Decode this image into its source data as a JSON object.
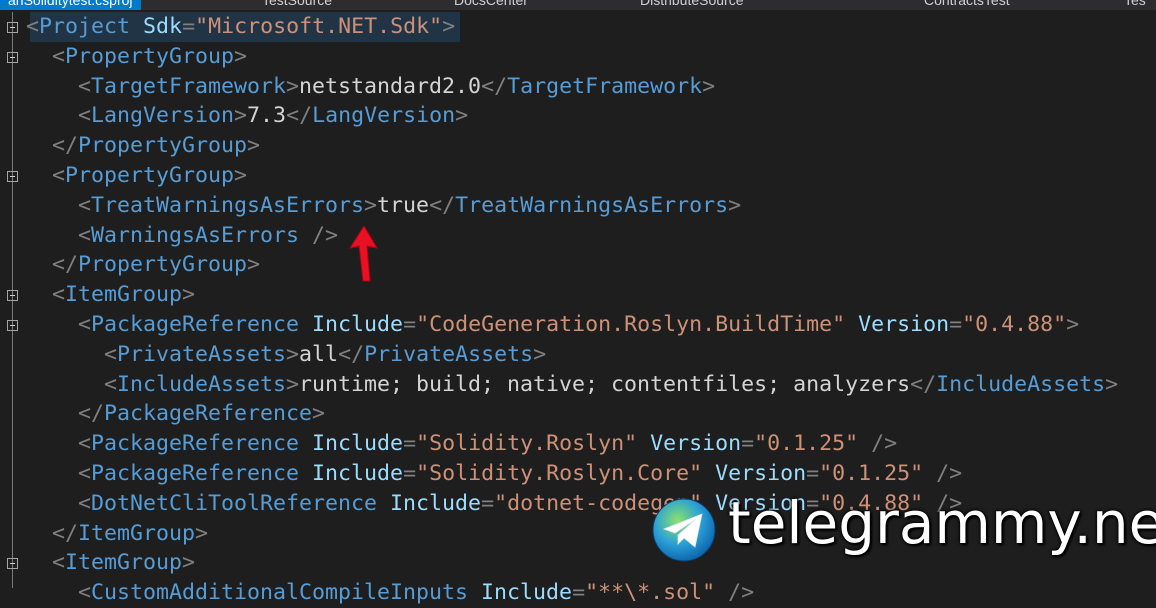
{
  "tabs": [
    {
      "label": "anSoliditytest.csproj",
      "active": true
    },
    {
      "label": "TestSource",
      "active": false
    },
    {
      "label": "DocsCenter",
      "active": false
    },
    {
      "label": "DistributeSource",
      "active": false
    },
    {
      "label": "ContractsTest",
      "active": false
    },
    {
      "label": "Tes",
      "active": false
    }
  ],
  "colors": {
    "background": "#1e1e1e",
    "punctuation": "#808080",
    "tag": "#569cd6",
    "attribute": "#9cdcfe",
    "string_value": "#ce9178",
    "text": "#d4d4d4",
    "arrow": "#e81123",
    "active_tab": "#007acc"
  },
  "code_lines": [
    {
      "collapsible": true,
      "tokens": [
        [
          "punct",
          "<"
        ],
        [
          "tag",
          "Project"
        ],
        [
          "txt",
          " "
        ],
        [
          "attr",
          "Sdk"
        ],
        [
          "punct",
          "="
        ],
        [
          "val",
          "\"Microsoft.NET.Sdk\""
        ],
        [
          "punct",
          ">"
        ]
      ]
    },
    {
      "collapsible": true,
      "tokens": [
        [
          "punct",
          "<"
        ],
        [
          "tag",
          "PropertyGroup"
        ],
        [
          "punct",
          ">"
        ]
      ]
    },
    {
      "collapsible": false,
      "tokens": [
        [
          "punct",
          "<"
        ],
        [
          "tag",
          "TargetFramework"
        ],
        [
          "punct",
          ">"
        ],
        [
          "txt",
          "netstandard2.0"
        ],
        [
          "punct",
          "</"
        ],
        [
          "tag",
          "TargetFramework"
        ],
        [
          "punct",
          ">"
        ]
      ]
    },
    {
      "collapsible": false,
      "tokens": [
        [
          "punct",
          "<"
        ],
        [
          "tag",
          "LangVersion"
        ],
        [
          "punct",
          ">"
        ],
        [
          "txt",
          "7.3"
        ],
        [
          "punct",
          "</"
        ],
        [
          "tag",
          "LangVersion"
        ],
        [
          "punct",
          ">"
        ]
      ]
    },
    {
      "collapsible": false,
      "tokens": [
        [
          "punct",
          "</"
        ],
        [
          "tag",
          "PropertyGroup"
        ],
        [
          "punct",
          ">"
        ]
      ]
    },
    {
      "collapsible": true,
      "tokens": [
        [
          "punct",
          "<"
        ],
        [
          "tag",
          "PropertyGroup"
        ],
        [
          "punct",
          ">"
        ]
      ]
    },
    {
      "collapsible": false,
      "tokens": [
        [
          "punct",
          "<"
        ],
        [
          "tag",
          "TreatWarningsAsErrors"
        ],
        [
          "punct",
          ">"
        ],
        [
          "txt",
          "true"
        ],
        [
          "punct",
          "</"
        ],
        [
          "tag",
          "TreatWarningsAsErrors"
        ],
        [
          "punct",
          ">"
        ]
      ]
    },
    {
      "collapsible": false,
      "tokens": [
        [
          "punct",
          "<"
        ],
        [
          "tag",
          "WarningsAsErrors"
        ],
        [
          "txt",
          " "
        ],
        [
          "punct",
          "/>"
        ]
      ]
    },
    {
      "collapsible": false,
      "tokens": [
        [
          "punct",
          "</"
        ],
        [
          "tag",
          "PropertyGroup"
        ],
        [
          "punct",
          ">"
        ]
      ]
    },
    {
      "collapsible": true,
      "tokens": [
        [
          "punct",
          "<"
        ],
        [
          "tag",
          "ItemGroup"
        ],
        [
          "punct",
          ">"
        ]
      ]
    },
    {
      "collapsible": true,
      "tokens": [
        [
          "punct",
          "<"
        ],
        [
          "tag",
          "PackageReference"
        ],
        [
          "txt",
          " "
        ],
        [
          "attr",
          "Include"
        ],
        [
          "punct",
          "="
        ],
        [
          "val",
          "\"CodeGeneration.Roslyn.BuildTime\""
        ],
        [
          "txt",
          " "
        ],
        [
          "attr",
          "Version"
        ],
        [
          "punct",
          "="
        ],
        [
          "val",
          "\"0.4.88\""
        ],
        [
          "punct",
          ">"
        ]
      ]
    },
    {
      "collapsible": false,
      "tokens": [
        [
          "punct",
          "<"
        ],
        [
          "tag",
          "PrivateAssets"
        ],
        [
          "punct",
          ">"
        ],
        [
          "txt",
          "all"
        ],
        [
          "punct",
          "</"
        ],
        [
          "tag",
          "PrivateAssets"
        ],
        [
          "punct",
          ">"
        ]
      ]
    },
    {
      "collapsible": false,
      "tokens": [
        [
          "punct",
          "<"
        ],
        [
          "tag",
          "IncludeAssets"
        ],
        [
          "punct",
          ">"
        ],
        [
          "txt",
          "runtime; build; native; contentfiles; analyzers"
        ],
        [
          "punct",
          "</"
        ],
        [
          "tag",
          "IncludeAssets"
        ],
        [
          "punct",
          ">"
        ]
      ]
    },
    {
      "collapsible": false,
      "tokens": [
        [
          "punct",
          "</"
        ],
        [
          "tag",
          "PackageReference"
        ],
        [
          "punct",
          ">"
        ]
      ]
    },
    {
      "collapsible": false,
      "tokens": [
        [
          "punct",
          "<"
        ],
        [
          "tag",
          "PackageReference"
        ],
        [
          "txt",
          " "
        ],
        [
          "attr",
          "Include"
        ],
        [
          "punct",
          "="
        ],
        [
          "val",
          "\"Solidity.Roslyn\""
        ],
        [
          "txt",
          " "
        ],
        [
          "attr",
          "Version"
        ],
        [
          "punct",
          "="
        ],
        [
          "val",
          "\"0.1.25\""
        ],
        [
          "txt",
          " "
        ],
        [
          "punct",
          "/>"
        ]
      ]
    },
    {
      "collapsible": false,
      "tokens": [
        [
          "punct",
          "<"
        ],
        [
          "tag",
          "PackageReference"
        ],
        [
          "txt",
          " "
        ],
        [
          "attr",
          "Include"
        ],
        [
          "punct",
          "="
        ],
        [
          "val",
          "\"Solidity.Roslyn.Core\""
        ],
        [
          "txt",
          " "
        ],
        [
          "attr",
          "Version"
        ],
        [
          "punct",
          "="
        ],
        [
          "val",
          "\"0.1.25\""
        ],
        [
          "txt",
          " "
        ],
        [
          "punct",
          "/>"
        ]
      ]
    },
    {
      "collapsible": false,
      "tokens": [
        [
          "punct",
          "<"
        ],
        [
          "tag",
          "DotNetCliToolReference"
        ],
        [
          "txt",
          " "
        ],
        [
          "attr",
          "Include"
        ],
        [
          "punct",
          "="
        ],
        [
          "val",
          "\"dotnet-codegen\""
        ],
        [
          "txt",
          " "
        ],
        [
          "attr",
          "Version"
        ],
        [
          "punct",
          "="
        ],
        [
          "val",
          "\"0.4.88\""
        ],
        [
          "txt",
          " "
        ],
        [
          "punct",
          "/>"
        ]
      ]
    },
    {
      "collapsible": false,
      "tokens": [
        [
          "punct",
          "</"
        ],
        [
          "tag",
          "ItemGroup"
        ],
        [
          "punct",
          ">"
        ]
      ]
    },
    {
      "collapsible": true,
      "tokens": [
        [
          "punct",
          "<"
        ],
        [
          "tag",
          "ItemGroup"
        ],
        [
          "punct",
          ">"
        ]
      ]
    },
    {
      "collapsible": false,
      "tokens": [
        [
          "punct",
          "<"
        ],
        [
          "tag",
          "CustomAdditionalCompileInputs"
        ],
        [
          "txt",
          " "
        ],
        [
          "attr",
          "Include"
        ],
        [
          "punct",
          "="
        ],
        [
          "val",
          "\"**\\*.sol\""
        ],
        [
          "txt",
          " "
        ],
        [
          "punct",
          "/>"
        ]
      ]
    }
  ],
  "annotation": {
    "icon": "red-arrow-icon"
  },
  "watermark": {
    "text": "telegrammy.net",
    "icon": "telegram-logo-icon"
  }
}
